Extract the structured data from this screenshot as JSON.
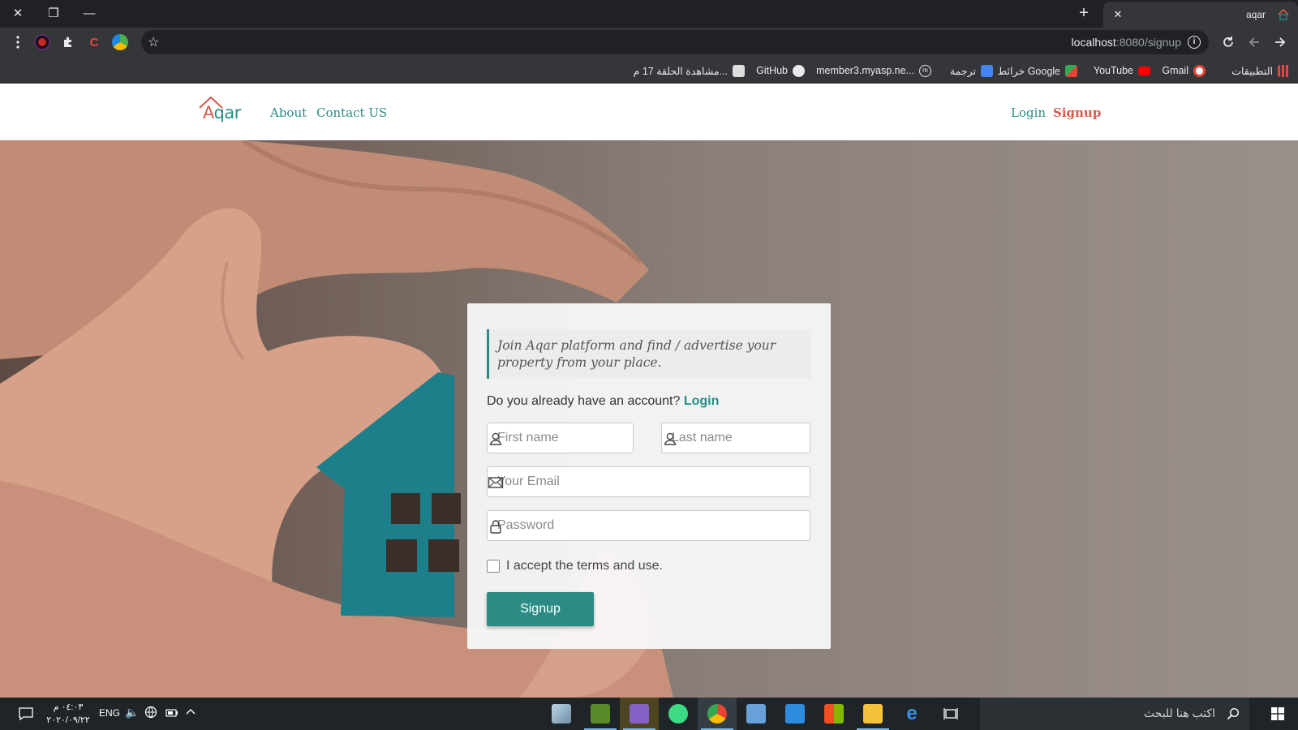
{
  "browser": {
    "tab": {
      "title": "aqar",
      "close": "✕"
    },
    "new_tab": "+",
    "window": {
      "close": "✕",
      "restore": "❐",
      "minimize": "—"
    },
    "address": {
      "host": "localhost",
      "path": ":8080/signup"
    },
    "bookmarks": [
      {
        "label": "التطبيقات",
        "color": "#e8453c"
      },
      {
        "label": "Gmail",
        "color": "#ffffff"
      },
      {
        "label": "YouTube",
        "color": "#ff0000"
      },
      {
        "label": "خرائط Google",
        "color": "#34a853"
      },
      {
        "label": "ترجمة",
        "color": "#4285f4"
      },
      {
        "label": "member3.myasp.ne...",
        "color": "#35363a"
      },
      {
        "label": "GitHub",
        "color": "#ffffff"
      },
      {
        "label": "مشاهدة الحلقة 17 م...",
        "color": "#dddddd"
      }
    ]
  },
  "site": {
    "logo": {
      "initial": "A",
      "rest": "qar"
    },
    "nav": {
      "about": "About",
      "contact": "Contact US",
      "login": "Login",
      "signup": "Signup"
    },
    "colors": {
      "primary": "#2a8c85",
      "accent": "#d65a4a"
    },
    "form": {
      "intro": "Join Aqar platform and find / advertise your property from your place.",
      "account_question": "Do you already have an account?",
      "account_login": "Login",
      "first_name_placeholder": "First name",
      "last_name_placeholder": "Last name",
      "email_placeholder": "Your Email",
      "password_placeholder": "Password",
      "terms": "I accept the terms and use.",
      "submit": "Signup"
    }
  },
  "taskbar": {
    "time": "٠٤:٠٣ م",
    "date": "٢٠٢٠/٠٩/٢٢",
    "lang": "ENG",
    "search_placeholder": "اكتب هنا للبحث"
  }
}
